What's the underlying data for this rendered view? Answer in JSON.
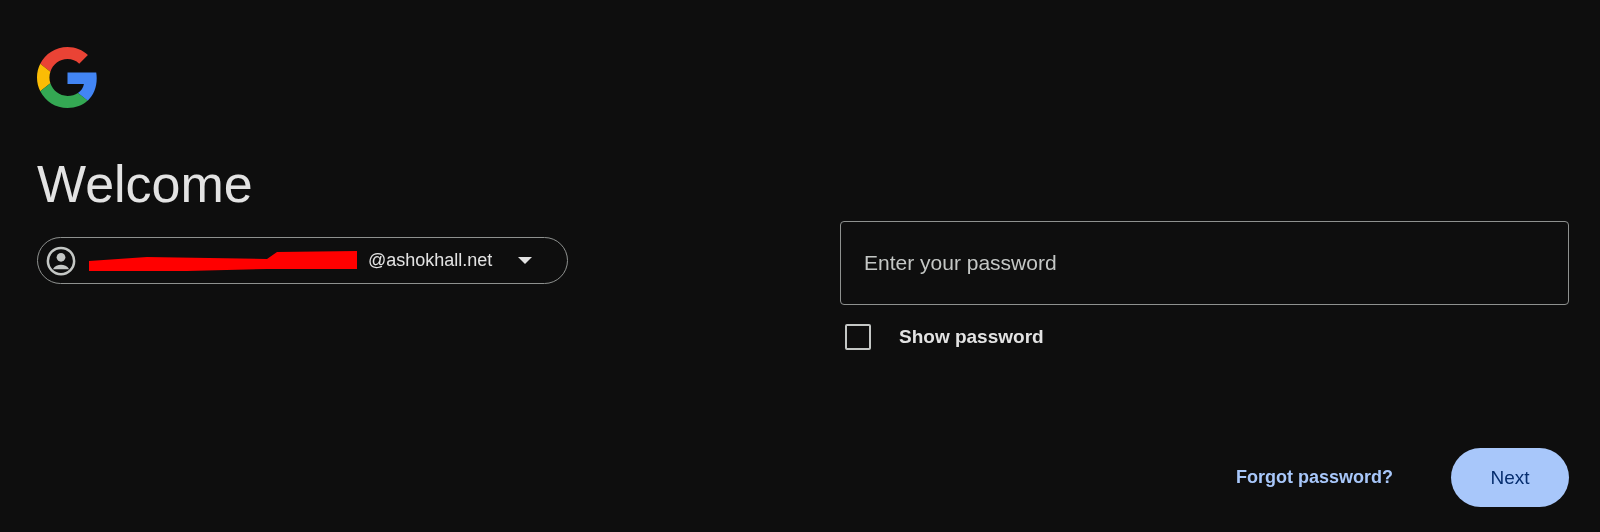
{
  "heading": "Welcome",
  "account": {
    "email": "@ashokhall.net",
    "redacted": true
  },
  "password_field": {
    "placeholder": "Enter your password"
  },
  "show_password": {
    "label": "Show password",
    "checked": false
  },
  "forgot_link": "Forgot password?",
  "next_button": "Next"
}
